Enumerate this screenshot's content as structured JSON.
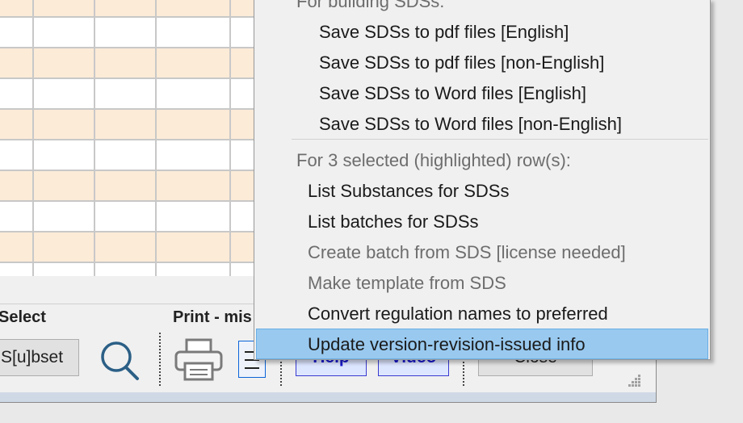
{
  "bottom_panel": {
    "select_label": "Select",
    "subset_button": "S[u]bset",
    "print_label": "Print - mis",
    "help_button": "Help",
    "video_button": "Video",
    "close_button": "Close"
  },
  "context_menu": {
    "partial_header": "For building SDSs:",
    "building_items": [
      "Save SDSs to pdf files [English]",
      "Save SDSs to pdf files [non-English]",
      "Save SDSs to Word files [English]",
      "Save SDSs to Word files [non-English]"
    ],
    "selected_header": "For 3 selected (highlighted) row(s):",
    "selected_items": [
      {
        "label": "List Substances for SDSs",
        "enabled": true
      },
      {
        "label": "List batches for SDSs",
        "enabled": true
      },
      {
        "label": "Create batch from SDS [license needed]",
        "enabled": false
      },
      {
        "label": "Make template from SDS",
        "enabled": false
      },
      {
        "label": "Convert regulation names to preferred",
        "enabled": true
      },
      {
        "label": "Update version-revision-issued info",
        "enabled": true,
        "highlighted": true
      }
    ]
  },
  "colors": {
    "row_odd": "#fcebd7",
    "row_even": "#ffffff",
    "highlight": "#99c9ef",
    "button_blue_text": "#1a1ad0"
  },
  "icons": [
    "search-icon",
    "printer-icon",
    "list-icon",
    "resize-grip-icon"
  ]
}
